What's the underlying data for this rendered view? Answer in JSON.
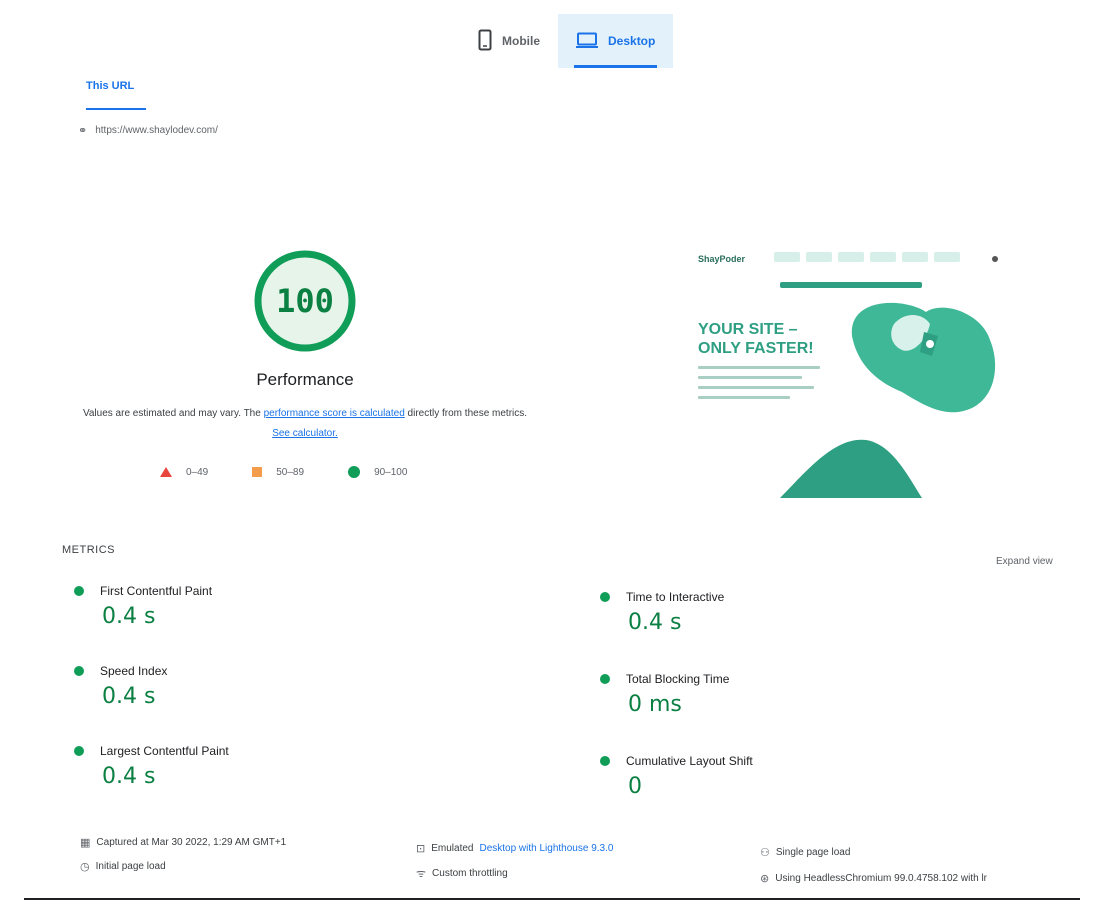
{
  "device_tabs": [
    {
      "label": "Mobile",
      "icon": "mobile-icon",
      "active": false
    },
    {
      "label": "Desktop",
      "icon": "desktop-icon",
      "active": true
    }
  ],
  "url_tab": {
    "label": "This URL"
  },
  "url": "https://www.shaylodev.com/",
  "score": {
    "value": "100",
    "value_fraction": 1.0,
    "category": "Performance",
    "color": "#0f9d58",
    "desc_prefix": "Values are estimated and may vary. The ",
    "desc_link1": "performance score is calculated",
    "desc_mid": " directly from these metrics. ",
    "desc_link2": "See calculator."
  },
  "legend": [
    {
      "shape": "triangle",
      "label": "0–49",
      "color": "#e8453c"
    },
    {
      "shape": "square",
      "label": "50–89",
      "color": "#f29d4b"
    },
    {
      "shape": "circle",
      "label": "90–100",
      "color": "#0f9d58"
    }
  ],
  "preview": {
    "logo": "ShayPoder",
    "headline_line1": "YOUR SITE –",
    "headline_line2": "ONLY FASTER!",
    "accent": "#2e9f82"
  },
  "metrics": {
    "title": "METRICS",
    "expand_label": "Expand view",
    "items": [
      {
        "label": "First Contentful Paint",
        "value": "0.4 s"
      },
      {
        "label": "Time to Interactive",
        "value": "0.4 s"
      },
      {
        "label": "Speed Index",
        "value": "0.4 s"
      },
      {
        "label": "Total Blocking Time",
        "value": "0 ms"
      },
      {
        "label": "Largest Contentful Paint",
        "value": "0.4 s"
      },
      {
        "label": "Cumulative Layout Shift",
        "value": "0"
      }
    ]
  },
  "footer": {
    "captured": "Captured at Mar 30 2022, 1:29 AM GMT+1",
    "initial_load": "Initial page load",
    "emulated_prefix": "Emulated ",
    "emulated_link": "Desktop with Lighthouse 9.3.0",
    "throttling": "Custom throttling",
    "single_load": "Single page load",
    "browser": "Using HeadlessChromium 99.0.4758.102 with lr"
  }
}
